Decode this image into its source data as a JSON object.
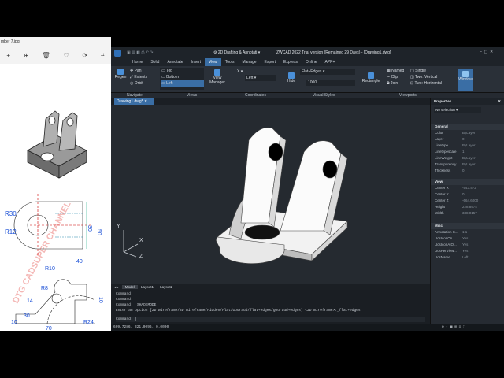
{
  "viewer": {
    "title": "mber 7.jpg",
    "drawing_labels": {
      "r30": "R30",
      "r12": "R12",
      "d50": "50",
      "d30": "30",
      "r10": "R10",
      "d40": "40",
      "r8": "R8",
      "d10": "10",
      "r24": "R24",
      "d70": "70",
      "d10b": "10",
      "d30b": "30",
      "d14": "14"
    },
    "watermark": "DTG CADSUPER CHANNEL"
  },
  "app": {
    "title": "ZWCAD 2022 Trial version (Remained 29 Days) - [Drawing1.dwg]",
    "workspace": "2D Drafting & Annotati",
    "tabs": [
      "Home",
      "Solid",
      "Annotate",
      "Insert",
      "View",
      "Tools",
      "Manage",
      "Export",
      "Express",
      "Online",
      "APP+"
    ],
    "active_tab": "View",
    "ribbon": {
      "regen": "Regen",
      "pan": "Pan",
      "extents": "Extents",
      "orbit": "Orbit",
      "views": [
        "Top",
        "Bottom",
        "Left"
      ],
      "view_manager": "View Manager",
      "coord_x": "X",
      "coord_select": "Left",
      "visual_style": "Flat+Edges",
      "hide": "Hide",
      "hide_value": "1000",
      "rectangle": "Rectangle",
      "named": "Named",
      "clip": "Clip",
      "join": "Join",
      "single": "Single",
      "two_vertical": "Two: Vertical",
      "two_horizontal": "Two: Horizontal",
      "window": "Window"
    },
    "panel_labels": [
      "Navigate",
      "Views",
      "Coordinates",
      "Visual Styles",
      "Viewports"
    ],
    "doc_tab": "Drawing1.dwg*",
    "layout_tabs": [
      "Model",
      "Layout1",
      "Layout2",
      "+"
    ],
    "command_lines": [
      "Command:",
      "Command:",
      "Command: _SHADEMODE",
      "Enter an option [2D wireframe/3D wireframe/Hidden/Flat/Gouraud/flat+edges/gOuraud+edges] <2D wireframe>:_flat+edges"
    ],
    "command_prompt": "Command:",
    "status_coords": "609.7286, 321.0096, 0.0000",
    "ucs": {
      "x": "X",
      "y": "Y",
      "z": "Z"
    }
  },
  "properties": {
    "title": "Properties",
    "selection": "No selection",
    "general_header": "General",
    "general": [
      {
        "label": "Color",
        "value": "ByLayer"
      },
      {
        "label": "Layer",
        "value": "0"
      },
      {
        "label": "Linetype",
        "value": "ByLayer"
      },
      {
        "label": "Linetypescale",
        "value": "1"
      },
      {
        "label": "LineWeight",
        "value": "ByLayer"
      },
      {
        "label": "Transparency",
        "value": "ByLayer"
      },
      {
        "label": "Thickness",
        "value": "0"
      }
    ],
    "view_header": "View",
    "view": [
      {
        "label": "Center X",
        "value": "-543.472"
      },
      {
        "label": "Center Y",
        "value": "0"
      },
      {
        "label": "Center Z",
        "value": "-664.6000"
      },
      {
        "label": "Height",
        "value": "228.8974"
      },
      {
        "label": "Width",
        "value": "338.0157"
      }
    ],
    "misc_header": "Misc",
    "misc": [
      {
        "label": "Annotation S...",
        "value": "1:1"
      },
      {
        "label": "UcsIconOn",
        "value": "Yes"
      },
      {
        "label": "UcsIconAtO...",
        "value": "Yes"
      },
      {
        "label": "UcsPerView...",
        "value": "Yes"
      },
      {
        "label": "UcsName",
        "value": "Left"
      }
    ]
  }
}
